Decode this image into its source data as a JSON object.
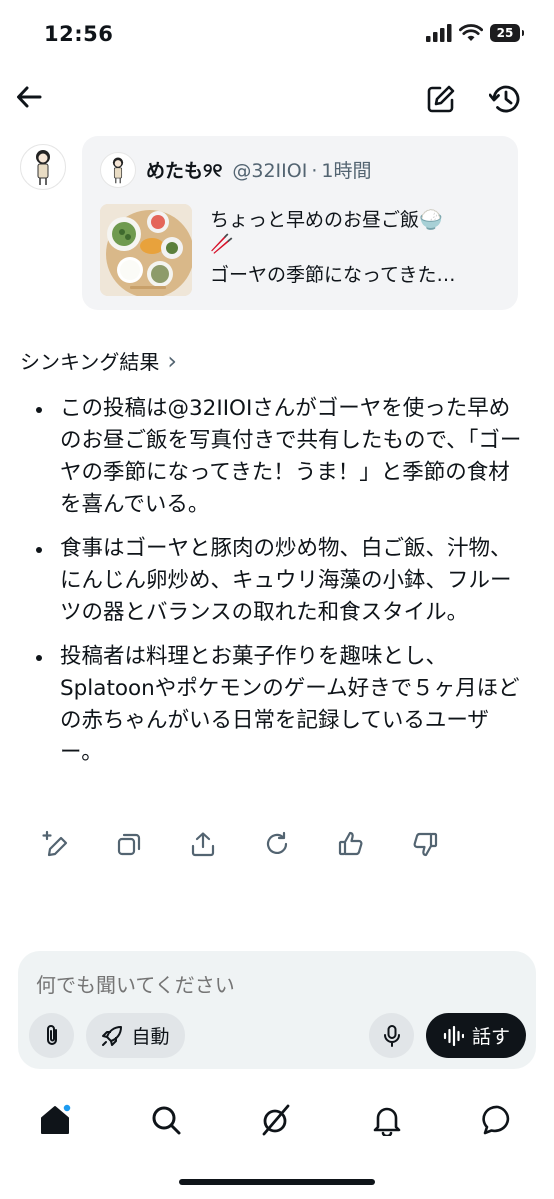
{
  "status_bar": {
    "time": "12:56",
    "battery": "25"
  },
  "header": {
    "back_icon": "arrow-left-icon",
    "compose_icon": "edit-icon",
    "history_icon": "history-icon"
  },
  "quoted_post": {
    "author_name": "めたも୨୧",
    "handle": "@32IIOI",
    "separator": "·",
    "time_ago": "1時間",
    "text_line1": "ちょっと早めのお昼ご飯🍚",
    "text_line2": "🥢",
    "text_line3": "ゴーヤの季節になってきた…"
  },
  "thinking": {
    "title": "シンキング結果",
    "chevron": "›",
    "bullets": [
      "この投稿は@32IIOIさんがゴーヤを使った早めのお昼ご飯を写真付きで共有したもので、「ゴーヤの季節になってきた！うま！」と季節の食材を喜んでいる。",
      "食事はゴーヤと豚肉の炒め物、白ご飯、汁物、にんじん卵炒め、キュウリ海藻の小鉢、フルーツの器とバランスの取れた和食スタイル。",
      "投稿者は料理とお菓子作りを趣味とし、Splatoonやポケモンのゲーム好きで５ヶ月ほどの赤ちゃんがいる日常を記録しているユーザー。"
    ]
  },
  "composer": {
    "placeholder": "何でも聞いてください",
    "mode_label": "自動",
    "talk_label": "話す"
  },
  "colors": {
    "text": "#0f1419",
    "muted": "#536471",
    "card_bg": "#f3f4f6",
    "composer_bg": "#eff3f4",
    "accent": "#1d9bf0"
  }
}
